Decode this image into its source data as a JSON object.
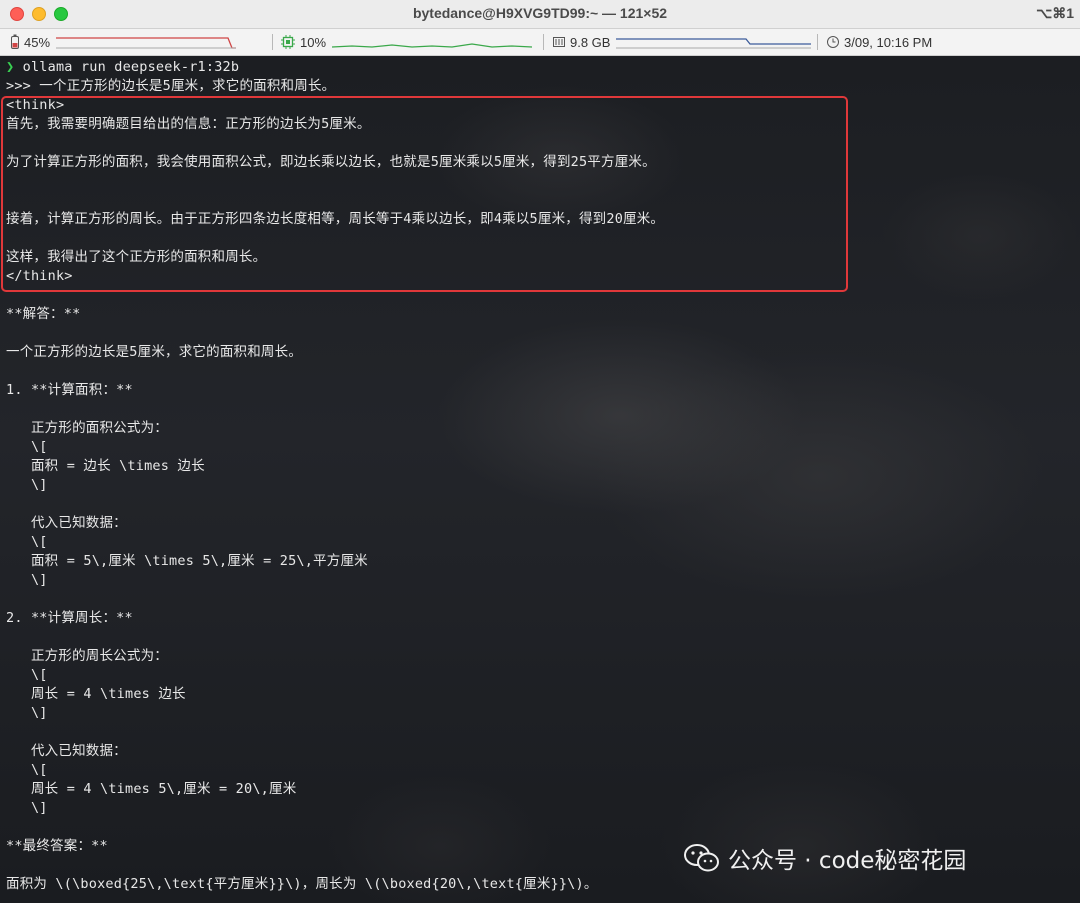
{
  "window": {
    "title": "bytedance@H9XVG9TD99:~ — 121×52",
    "shortcut": "⌥⌘1"
  },
  "status": {
    "battery": "45%",
    "cpu": "10%",
    "memory": "9.8 GB",
    "datetime": "3/09, 10:16 PM",
    "battery_level": 0.45,
    "colors": {
      "cpu_graph": "#3aa84a",
      "battery_graph": "#d04545",
      "memory_graph": "#3b5b9a"
    }
  },
  "terminal": {
    "prompt_symbol": "❯",
    "command": " ollama run deepseek-r1:32b",
    "lines": [
      ">>> 一个正方形的边长是5厘米，求它的面积和周长。",
      "<think>",
      "首先，我需要明确题目给出的信息：正方形的边长为5厘米。",
      "",
      "为了计算正方形的面积，我会使用面积公式，即边长乘以边长，也就是5厘米乘以5厘米，得到25平方厘米。",
      "",
      "",
      "接着，计算正方形的周长。由于正方形四条边长度相等，周长等于4乘以边长，即4乘以5厘米，得到20厘米。",
      "",
      "这样，我得出了这个正方形的面积和周长。",
      "</think>",
      "",
      "**解答：**",
      "",
      "一个正方形的边长是5厘米，求它的面积和周长。",
      "",
      "1. **计算面积：**",
      "",
      "   正方形的面积公式为：",
      "   \\[",
      "   面积 = 边长 \\times 边长",
      "   \\]",
      "",
      "   代入已知数据：",
      "   \\[",
      "   面积 = 5\\,厘米 \\times 5\\,厘米 = 25\\,平方厘米",
      "   \\]",
      "",
      "2. **计算周长：**",
      "",
      "   正方形的周长公式为：",
      "   \\[",
      "   周长 = 4 \\times 边长",
      "   \\]",
      "",
      "   代入已知数据：",
      "   \\[",
      "   周长 = 4 \\times 5\\,厘米 = 20\\,厘米",
      "   \\]",
      "",
      "**最终答案：**",
      "",
      "面积为 \\(\\boxed{25\\,\\text{平方厘米}}\\)，周长为 \\(\\boxed{20\\,\\text{厘米}}\\)。"
    ],
    "highlight_color": "#e0383a"
  },
  "watermark": {
    "text": "公众号 · code秘密花园",
    "icon": "wechat-icon"
  }
}
